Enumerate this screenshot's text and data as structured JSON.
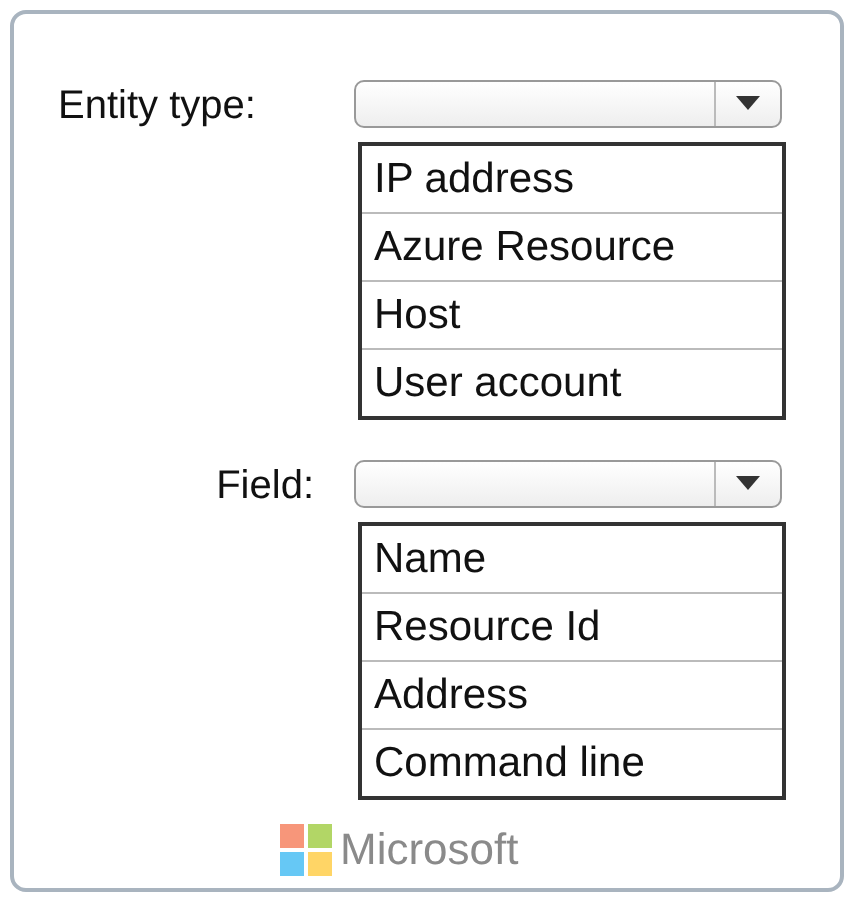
{
  "groups": [
    {
      "label": "Entity type:",
      "options": [
        "IP address",
        "Azure Resource",
        "Host",
        "User account"
      ]
    },
    {
      "label": "Field:",
      "options": [
        "Name",
        "Resource Id",
        "Address",
        "Command line"
      ]
    }
  ],
  "footer": {
    "logo_text": "Microsoft"
  }
}
